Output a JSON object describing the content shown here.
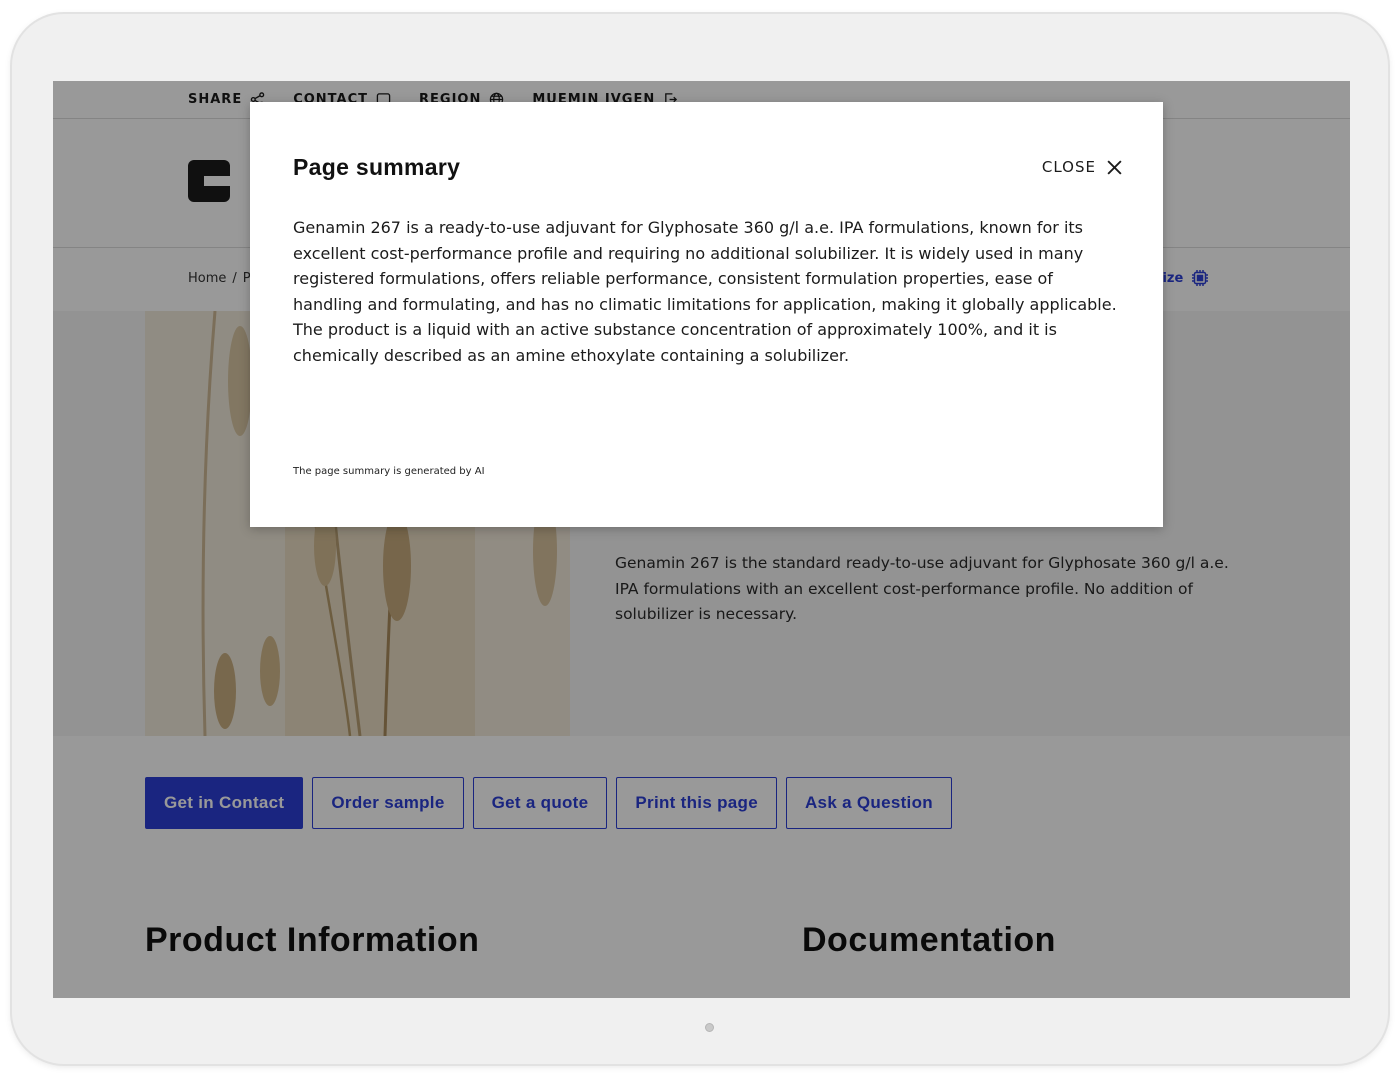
{
  "topbar": {
    "items": [
      {
        "label": "SHARE",
        "icon": "share-icon"
      },
      {
        "label": "CONTACT",
        "icon": "chat-icon"
      },
      {
        "label": "REGION",
        "icon": "globe-icon"
      },
      {
        "label": "MUEMIN IVGEN",
        "icon": "logout-icon"
      }
    ]
  },
  "breadcrumb": {
    "home": "Home",
    "separator": "/",
    "next": "P"
  },
  "summarize": {
    "label": "narize",
    "icon": "ai-chip-icon"
  },
  "hero": {
    "description": "Genamin 267 is the standard ready-to-use adjuvant for Glyphosate 360 g/l a.e. IPA formulations with an excellent cost-performance profile. No addition of solubilizer is necessary."
  },
  "actions": {
    "get_in_contact": "Get in Contact",
    "order_sample": "Order sample",
    "get_quote": "Get a quote",
    "print_page": "Print this page",
    "ask_question": "Ask a Question"
  },
  "sections": {
    "product_info": "Product Information",
    "documentation": "Documentation"
  },
  "modal": {
    "title": "Page summary",
    "close_label": "CLOSE",
    "body": "Genamin 267 is a ready-to-use adjuvant for Glyphosate 360 g/l a.e. IPA formulations, known for its excellent cost-performance profile and requiring no additional solubilizer. It is widely used in many registered formulations, offers reliable performance, consistent formulation properties, ease of handling and formulating, and has no climatic limitations for application, making it globally applicable. The product is a liquid with an active substance concentration of approximately 100%, and it is chemically described as an amine ethoxylate containing a solubilizer.",
    "footnote": "The page summary is generated by AI"
  },
  "colors": {
    "accent": "#2c3fd6",
    "overlay": "rgba(0,0,0,0.40)"
  }
}
